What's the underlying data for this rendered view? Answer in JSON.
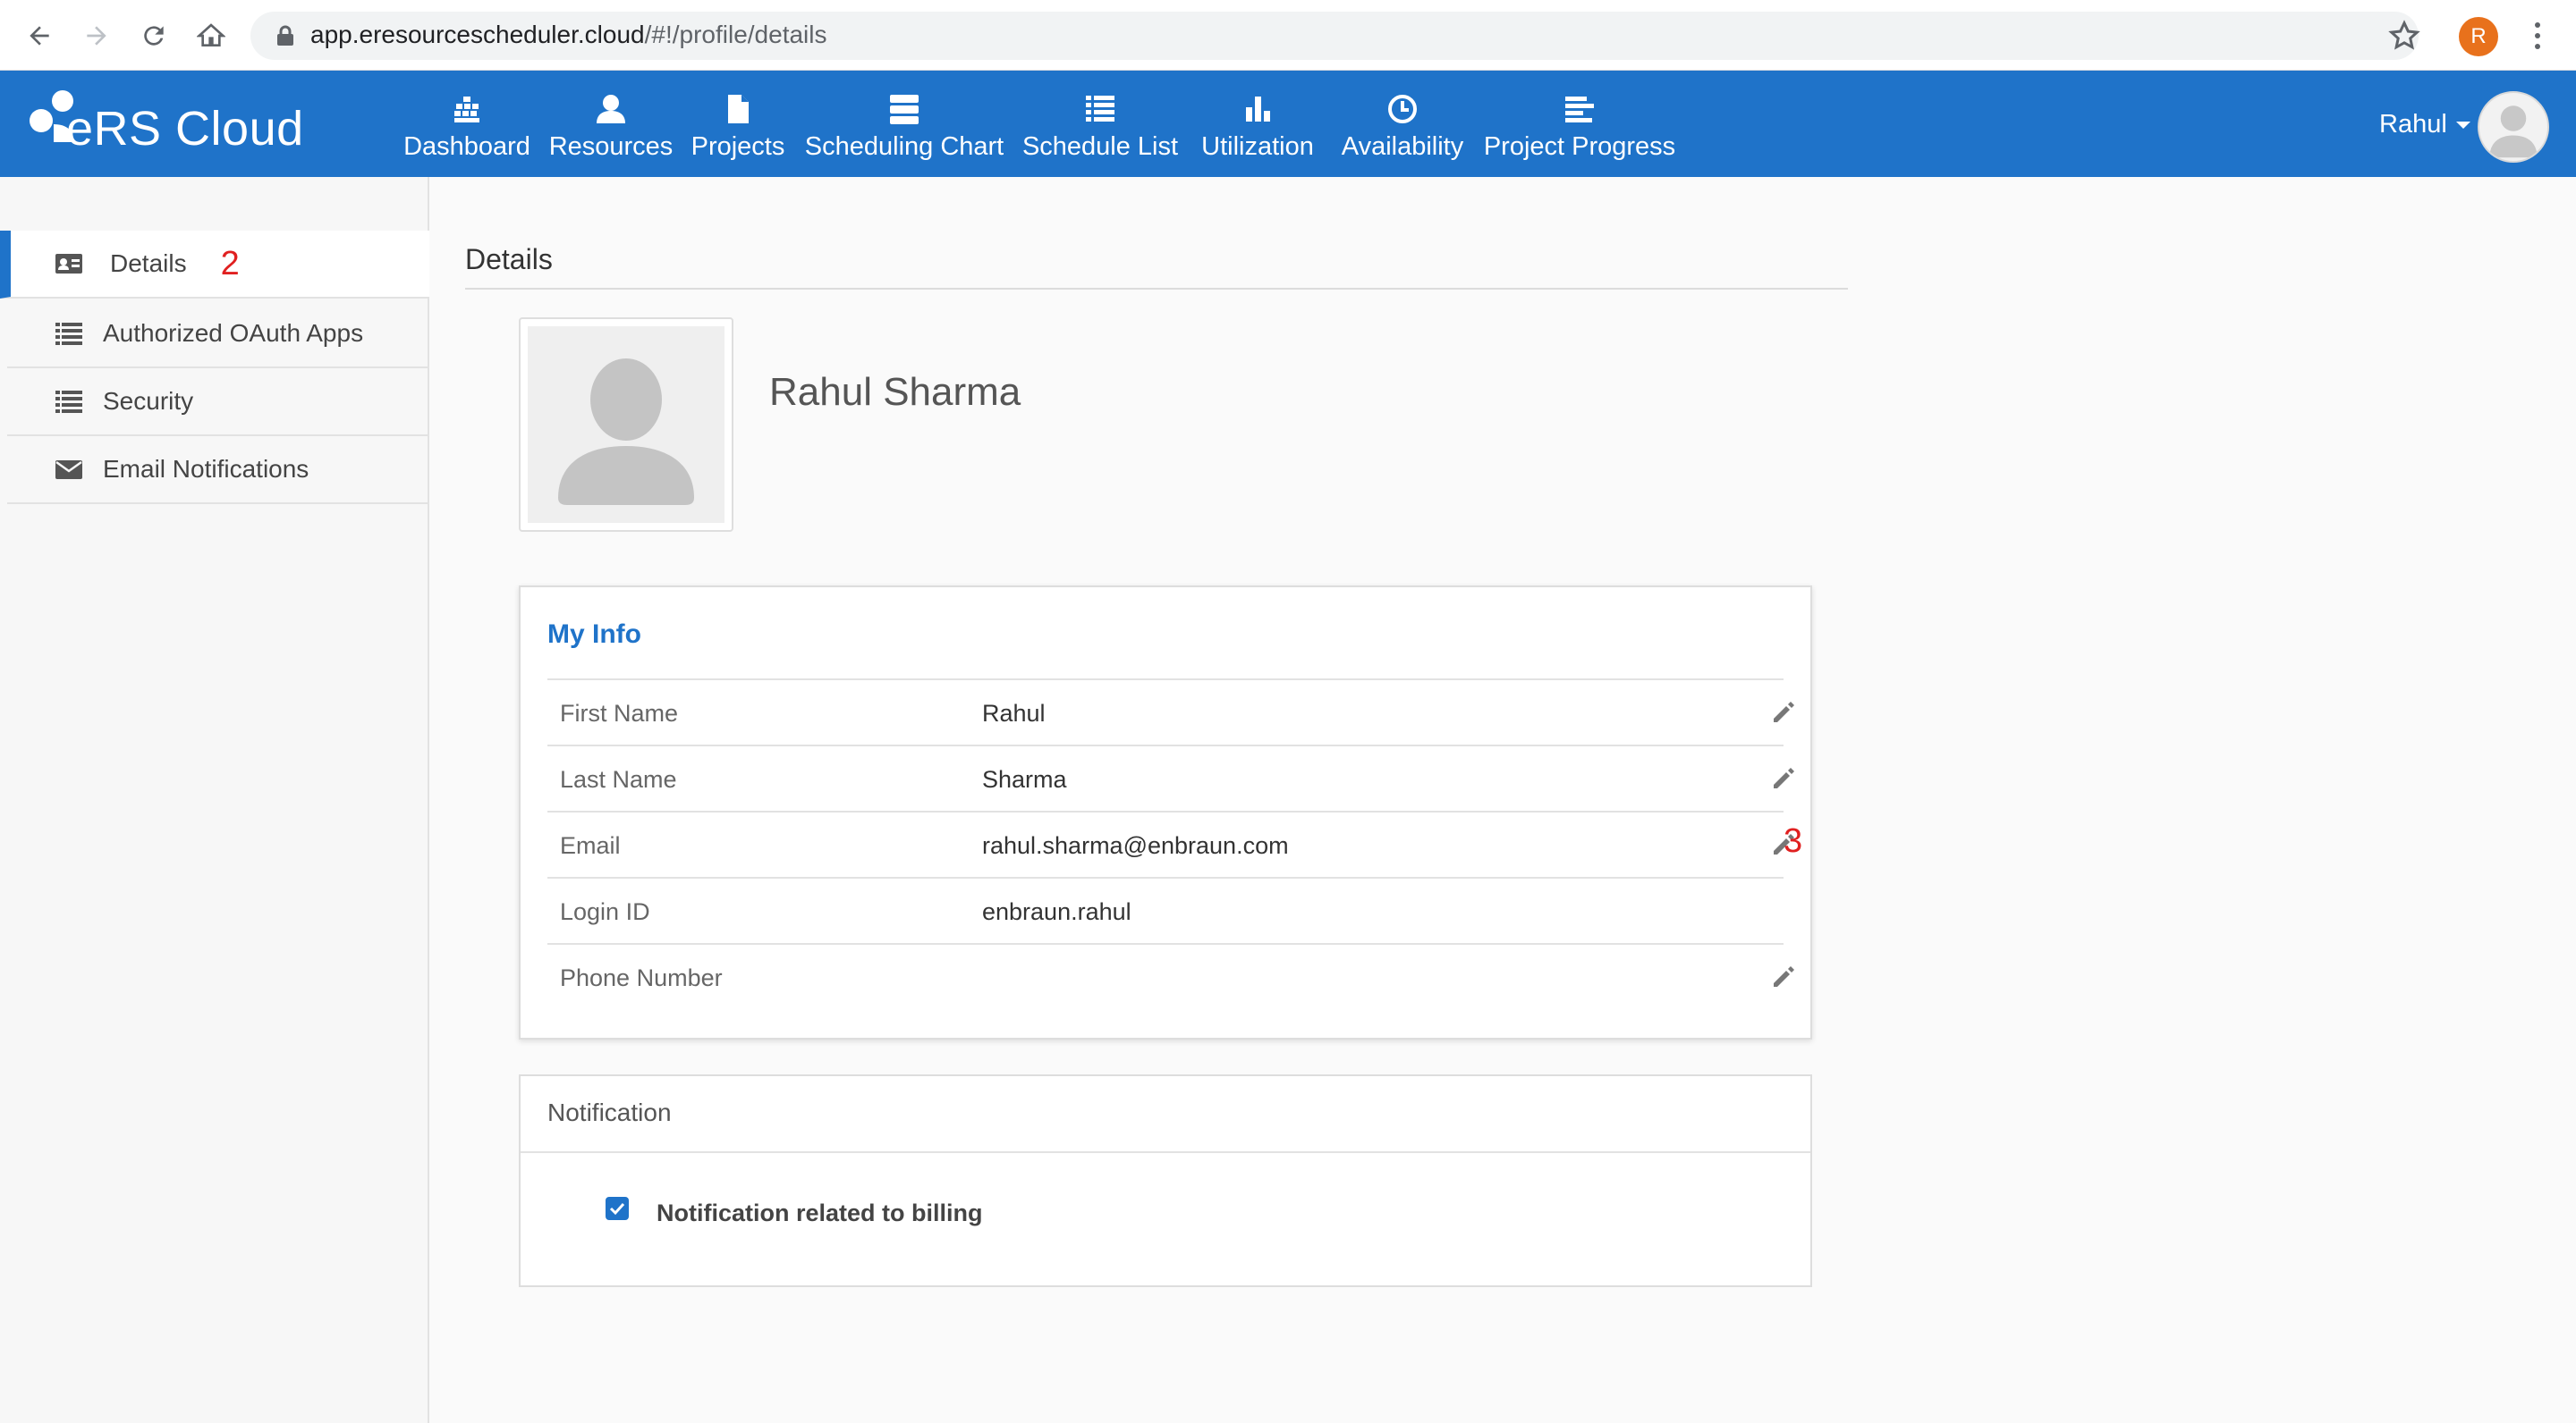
{
  "browser": {
    "url_host": "app.eresourcescheduler.cloud",
    "url_path": "/#!/profile/details",
    "profile_initial": "R"
  },
  "app": {
    "logo": "eRS Cloud",
    "nav": [
      {
        "label": "Dashboard",
        "icon": "dashboard-icon"
      },
      {
        "label": "Resources",
        "icon": "user-icon"
      },
      {
        "label": "Projects",
        "icon": "file-icon"
      },
      {
        "label": "Scheduling Chart",
        "icon": "server-icon"
      },
      {
        "label": "Schedule List",
        "icon": "list-icon"
      },
      {
        "label": "Utilization",
        "icon": "bar-chart-icon"
      },
      {
        "label": "Availability",
        "icon": "clock-icon"
      },
      {
        "label": "Project Progress",
        "icon": "progress-icon"
      }
    ],
    "user": "Rahul"
  },
  "sidebar": {
    "items": [
      {
        "label": "Details",
        "icon": "id-card-icon",
        "annotation": "2"
      },
      {
        "label": "Authorized OAuth Apps",
        "icon": "list-icon"
      },
      {
        "label": "Security",
        "icon": "list-icon"
      },
      {
        "label": "Email Notifications",
        "icon": "envelope-icon"
      }
    ]
  },
  "main": {
    "title": "Details",
    "profile_name": "Rahul Sharma",
    "my_info": {
      "heading": "My Info",
      "rows": [
        {
          "label": "First Name",
          "value": "Rahul",
          "editable": true
        },
        {
          "label": "Last Name",
          "value": "Sharma",
          "editable": true
        },
        {
          "label": "Email",
          "value": "rahul.sharma@enbraun.com",
          "editable": true
        },
        {
          "label": "Login ID",
          "value": "enbraun.rahul",
          "editable": false
        },
        {
          "label": "Phone Number",
          "value": "",
          "editable": true
        }
      ],
      "annotation": "3"
    },
    "notification": {
      "heading": "Notification",
      "option_label": "Notification related to billing",
      "checked": true
    }
  },
  "colors": {
    "brand": "#1f73c9",
    "annotation": "#e02020"
  }
}
